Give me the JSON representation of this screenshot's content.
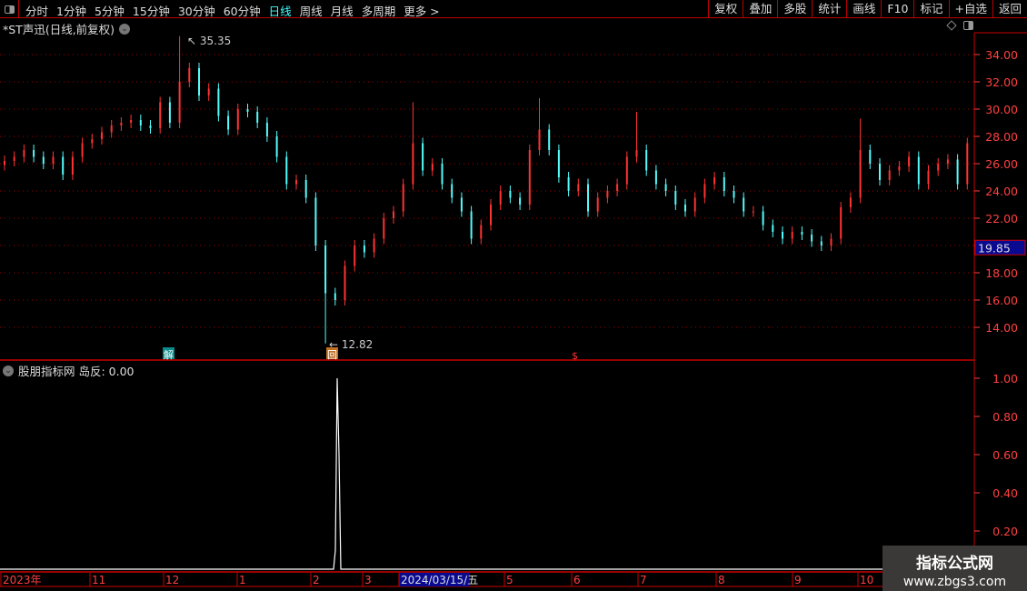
{
  "toolbar": {
    "periods": [
      "分时",
      "1分钟",
      "5分钟",
      "15分钟",
      "30分钟",
      "60分钟",
      "日线",
      "周线",
      "月线",
      "多周期",
      "更多 >"
    ],
    "active_period": "日线",
    "right_buttons": [
      "复权",
      "叠加",
      "多股",
      "统计",
      "画线",
      "F10",
      "标记",
      "+自选",
      "返回"
    ]
  },
  "chart": {
    "title": "*ST声迅(日线,前复权)",
    "high_label": "35.35",
    "low_label": "12.82",
    "current_price": "19.85",
    "price_axis": [
      "34.00",
      "32.00",
      "30.00",
      "28.00",
      "26.00",
      "24.00",
      "22.00",
      "20.00",
      "18.00",
      "16.00",
      "14.00"
    ],
    "markers": {
      "unlock": "解",
      "return": "回",
      "signal": "$"
    },
    "colors": {
      "up": "#ff3232",
      "down": "#54fcfc",
      "grid": "#a00000",
      "axis": "#ff4040",
      "highlight_bg": "#0a0a90"
    },
    "closes": [
      26.2,
      26.5,
      27,
      26.5,
      26,
      26.5,
      25.2,
      26.5,
      27.5,
      27.8,
      28.3,
      28.8,
      29,
      29.2,
      28.8,
      28.6,
      30.5,
      29,
      32,
      33,
      31,
      31.5,
      29.5,
      28.5,
      30,
      29.8,
      29,
      28,
      26.5,
      24.5,
      24.8,
      23.5,
      20,
      16.5,
      16,
      18.5,
      20,
      19.5,
      20.5,
      22,
      22.5,
      24.5,
      27.5,
      25.5,
      26,
      24.5,
      23.5,
      22.5,
      20.5,
      21.5,
      23,
      24,
      23.5,
      23,
      27,
      28.5,
      27,
      25,
      24,
      24.5,
      22.5,
      23.5,
      24,
      24.5,
      26.5,
      27,
      25.5,
      24.5,
      24,
      23,
      22.5,
      23.5,
      24.5,
      25,
      24,
      23.5,
      22.5,
      22.5,
      21.5,
      21,
      20.5,
      21,
      20.8,
      20.3,
      20,
      20.5,
      22.8,
      23.5,
      27,
      26,
      24.8,
      25.5,
      25.8,
      26.5,
      24.5,
      25.5,
      26,
      26.3,
      24.5,
      27.5
    ],
    "wick_overrides": {
      "18": {
        "h": 35.35
      },
      "33": {
        "l": 12.82
      },
      "42": {
        "h": 30.5
      },
      "55": {
        "h": 30.8
      },
      "65": {
        "h": 29.8
      },
      "88": {
        "h": 29.3
      }
    }
  },
  "indicator": {
    "title": "股朋指标网 岛反: 0.00",
    "axis": [
      "1.00",
      "0.80",
      "0.60",
      "0.40",
      "0.20"
    ],
    "spike_value": 1.0
  },
  "time_axis": {
    "labels": [
      "2023年",
      "11",
      "12",
      "1",
      "2",
      "3",
      "2024/03/15/五",
      "5",
      "6",
      "7",
      "8",
      "9",
      "10"
    ],
    "highlight": "2024/03/15/五"
  },
  "watermark": {
    "name": "指标公式网",
    "url": "www.zbgs3.com"
  }
}
